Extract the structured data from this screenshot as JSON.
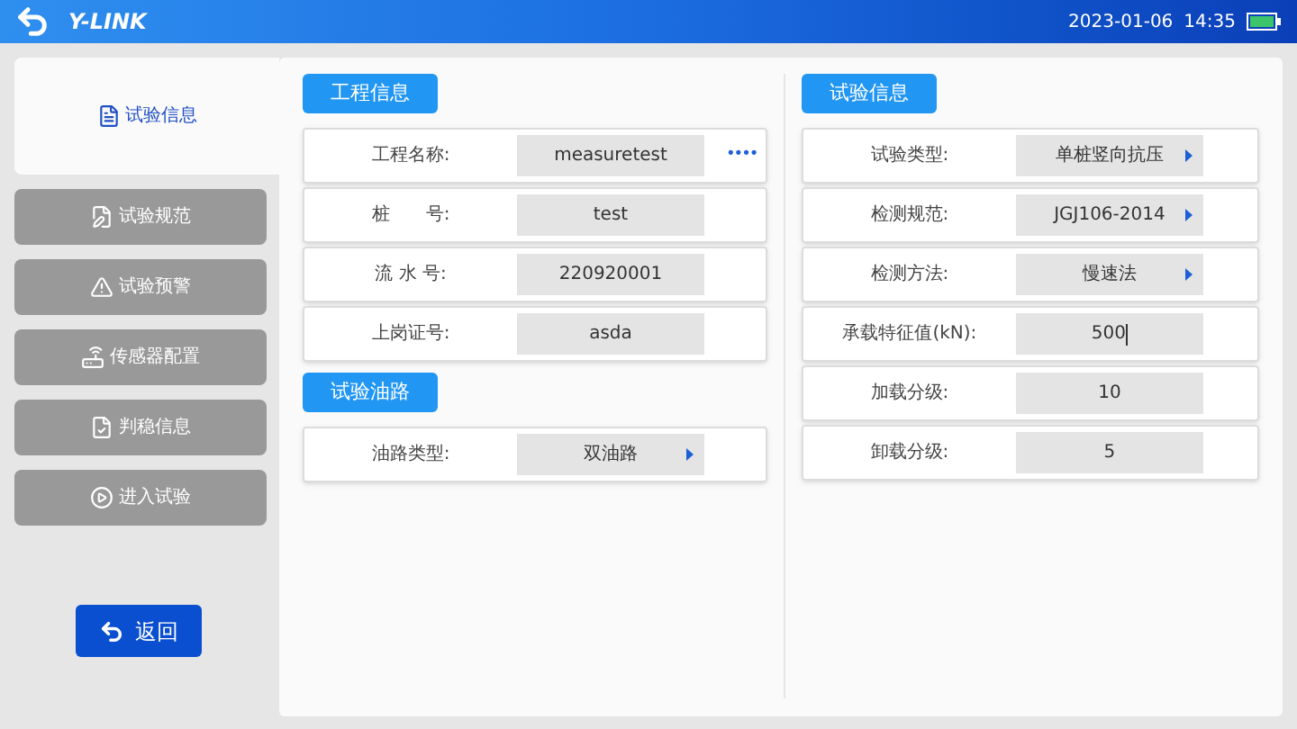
{
  "header": {
    "logo": "Y-LINK",
    "date": "2023-01-06",
    "time": "14:35"
  },
  "sidebar": {
    "items": [
      {
        "label": "试验信息",
        "selected": true
      },
      {
        "label": "试验规范",
        "selected": false
      },
      {
        "label": "试验预警",
        "selected": false
      },
      {
        "label": "传感器配置",
        "selected": false
      },
      {
        "label": "判稳信息",
        "selected": false
      },
      {
        "label": "进入试验",
        "selected": false
      }
    ],
    "back_button": "返回"
  },
  "left": [
    {
      "title": "工程信息",
      "rows": [
        {
          "label": "工程名称:",
          "value": "measuretest",
          "kind": "picker",
          "picker_icon": "••••"
        },
        {
          "label": "桩　　号:",
          "value": "test",
          "kind": "text"
        },
        {
          "label": "流 水 号:",
          "value": "220920001",
          "kind": "text"
        },
        {
          "label": "上岗证号:",
          "value": "asda",
          "kind": "text"
        }
      ]
    },
    {
      "title": "试验油路",
      "rows": [
        {
          "label": "油路类型:",
          "value": "双油路",
          "kind": "select"
        }
      ]
    }
  ],
  "right": [
    {
      "title": "试验信息",
      "rows": [
        {
          "label": "试验类型:",
          "value": "单桩竖向抗压",
          "kind": "select"
        },
        {
          "label": "检测规范:",
          "value": "JGJ106-2014",
          "kind": "select"
        },
        {
          "label": "检测方法:",
          "value": "慢速法",
          "kind": "select"
        },
        {
          "label": "承载特征值(kN):",
          "value": "500",
          "kind": "text",
          "focused": true
        },
        {
          "label": "加载分级:",
          "value": "10",
          "kind": "text"
        },
        {
          "label": "卸载分级:",
          "value": "5",
          "kind": "text"
        }
      ]
    }
  ]
}
